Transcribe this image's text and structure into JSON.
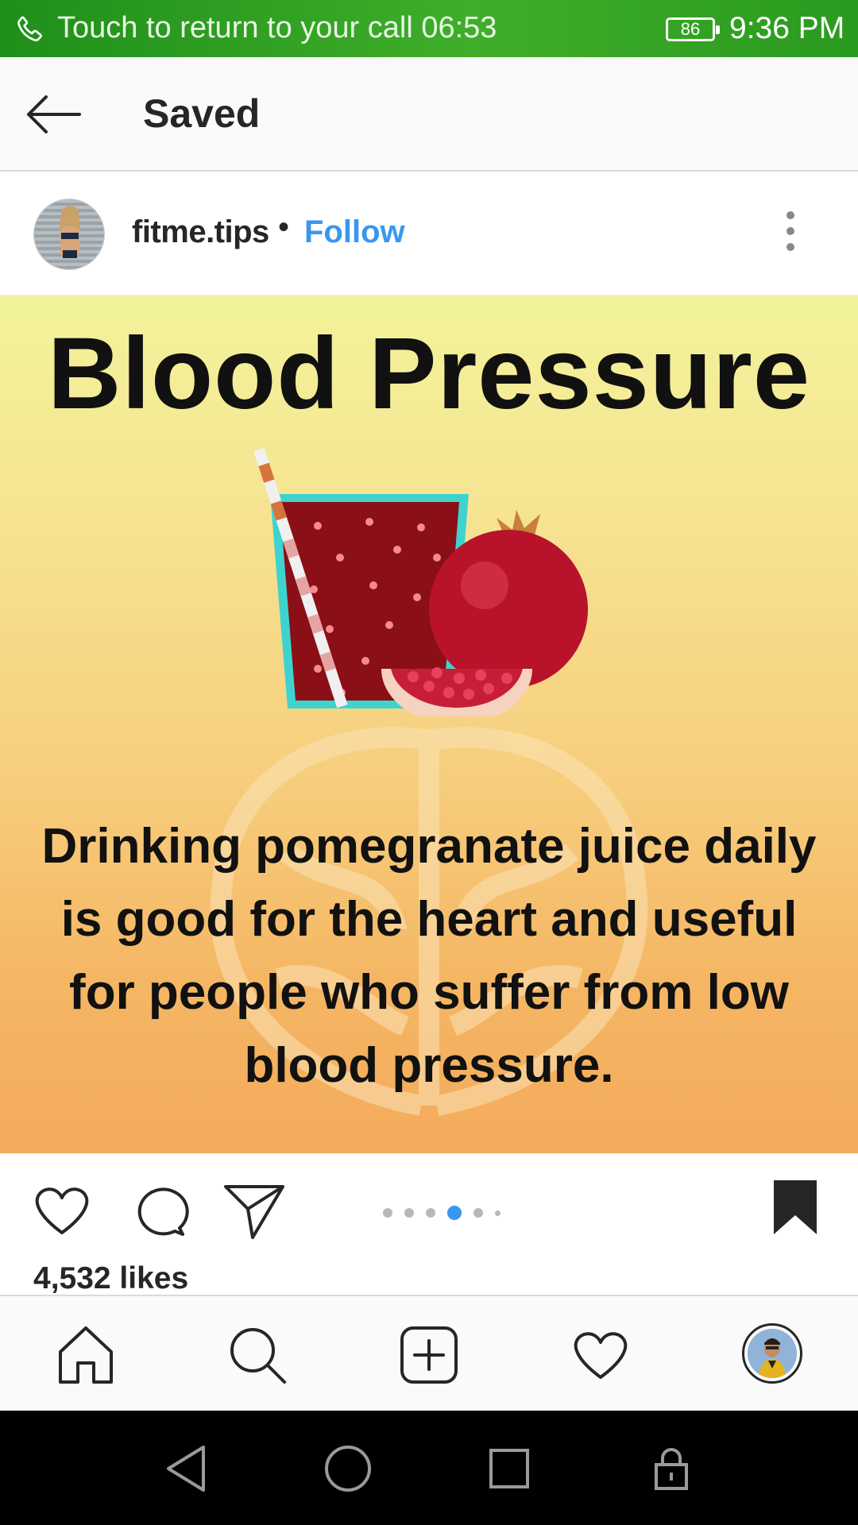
{
  "status_bar": {
    "call_text": "Touch to return to your call",
    "call_timer": "06:53",
    "battery": "86",
    "time": "9:36 PM"
  },
  "header": {
    "title": "Saved",
    "back_icon": "arrow-left-icon"
  },
  "post": {
    "username": "fitme.tips",
    "separator": "•",
    "follow_label": "Follow",
    "more_icon": "more-vertical-icon",
    "image_title": "Blood Pressure",
    "image_caption_lines": [
      "Drinking pomegranate juice daily",
      "is good for the heart and useful",
      "for people who suffer from low",
      "blood pressure."
    ],
    "carousel": {
      "count": 6,
      "active_index": 3
    },
    "likes": "4,532 likes"
  },
  "actions": {
    "like_icon": "heart-icon",
    "comment_icon": "comment-icon",
    "share_icon": "send-icon",
    "save_icon": "bookmark-filled-icon"
  },
  "bottom_nav": [
    "home-icon",
    "search-icon",
    "add-post-icon",
    "activity-heart-icon",
    "profile-avatar"
  ],
  "system_nav": [
    "back-triangle-icon",
    "home-circle-icon",
    "recents-square-icon",
    "lock-icon"
  ],
  "colors": {
    "status_bar_green": "#2a9a1f",
    "follow_blue": "#3897f0",
    "text_dark": "#262626"
  }
}
